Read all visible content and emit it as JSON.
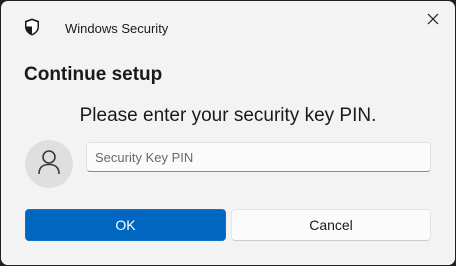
{
  "titlebar": {
    "app_title": "Windows Security",
    "icon": "shield-icon",
    "close_icon": "close-icon"
  },
  "dialog": {
    "heading": "Continue setup",
    "prompt": "Please enter your security key PIN.",
    "avatar_icon": "user-icon",
    "pin_input": {
      "placeholder": "Security Key PIN",
      "value": ""
    }
  },
  "buttons": {
    "ok_label": "OK",
    "cancel_label": "Cancel"
  },
  "colors": {
    "accent": "#0067c0",
    "background": "#f3f3f3"
  }
}
